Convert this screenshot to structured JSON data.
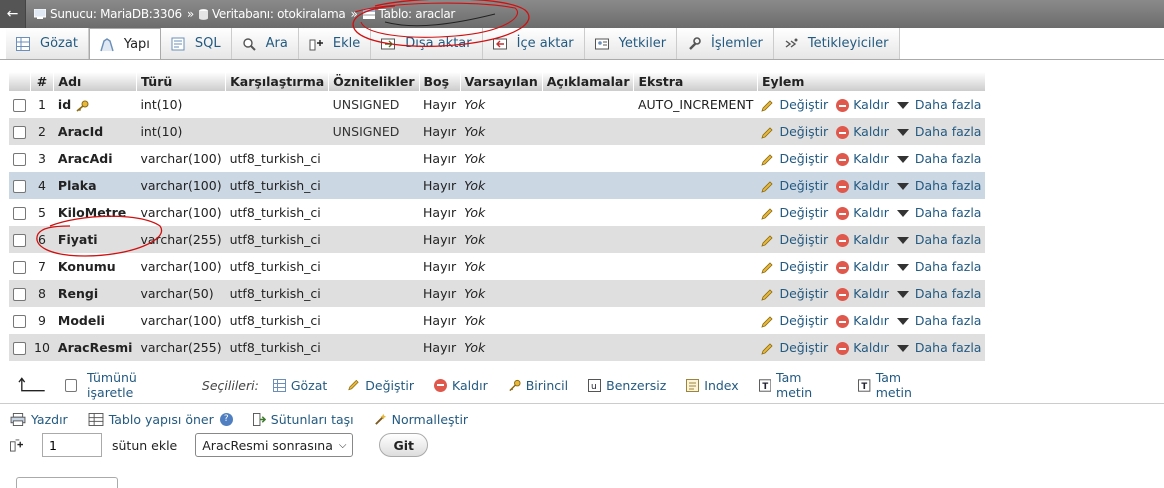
{
  "breadcrumb": {
    "server": "Sunucu: MariaDB:3306",
    "database": "Veritabanı: otokiralama",
    "table": "Tablo: araclar",
    "sep": "»"
  },
  "tabs": [
    {
      "label": "Gözat",
      "icon": "browse-icon"
    },
    {
      "label": "Yapı",
      "icon": "structure-icon",
      "active": true
    },
    {
      "label": "SQL",
      "icon": "sql-icon"
    },
    {
      "label": "Ara",
      "icon": "search-icon"
    },
    {
      "label": "Ekle",
      "icon": "insert-icon"
    },
    {
      "label": "Dışa aktar",
      "icon": "export-icon"
    },
    {
      "label": "İçe aktar",
      "icon": "import-icon"
    },
    {
      "label": "Yetkiler",
      "icon": "privileges-icon"
    },
    {
      "label": "İşlemler",
      "icon": "operations-icon"
    },
    {
      "label": "Tetikleyiciler",
      "icon": "triggers-icon"
    }
  ],
  "columns": [
    "#",
    "Adı",
    "Türü",
    "Karşılaştırma",
    "Öznitelikler",
    "Boş",
    "Varsayılan",
    "Açıklamalar",
    "Ekstra",
    "Eylem"
  ],
  "rows": [
    {
      "num": "1",
      "name": "id",
      "type": "int(10)",
      "collation": "",
      "attributes": "UNSIGNED",
      "null": "Hayır",
      "default": "Yok",
      "comments": "",
      "extra": "AUTO_INCREMENT",
      "primary": true
    },
    {
      "num": "2",
      "name": "AracId",
      "type": "int(10)",
      "collation": "",
      "attributes": "UNSIGNED",
      "null": "Hayır",
      "default": "Yok",
      "comments": "",
      "extra": ""
    },
    {
      "num": "3",
      "name": "AracAdi",
      "type": "varchar(100)",
      "collation": "utf8_turkish_ci",
      "attributes": "",
      "null": "Hayır",
      "default": "Yok",
      "comments": "",
      "extra": ""
    },
    {
      "num": "4",
      "name": "Plaka",
      "type": "varchar(100)",
      "collation": "utf8_turkish_ci",
      "attributes": "",
      "null": "Hayır",
      "default": "Yok",
      "comments": "",
      "extra": "",
      "highlight": true
    },
    {
      "num": "5",
      "name": "KiloMetre",
      "type": "varchar(100)",
      "collation": "utf8_turkish_ci",
      "attributes": "",
      "null": "Hayır",
      "default": "Yok",
      "comments": "",
      "extra": ""
    },
    {
      "num": "6",
      "name": "Fiyati",
      "type": "varchar(255)",
      "collation": "utf8_turkish_ci",
      "attributes": "",
      "null": "Hayır",
      "default": "Yok",
      "comments": "",
      "extra": ""
    },
    {
      "num": "7",
      "name": "Konumu",
      "type": "varchar(100)",
      "collation": "utf8_turkish_ci",
      "attributes": "",
      "null": "Hayır",
      "default": "Yok",
      "comments": "",
      "extra": ""
    },
    {
      "num": "8",
      "name": "Rengi",
      "type": "varchar(50)",
      "collation": "utf8_turkish_ci",
      "attributes": "",
      "null": "Hayır",
      "default": "Yok",
      "comments": "",
      "extra": ""
    },
    {
      "num": "9",
      "name": "Modeli",
      "type": "varchar(100)",
      "collation": "utf8_turkish_ci",
      "attributes": "",
      "null": "Hayır",
      "default": "Yok",
      "comments": "",
      "extra": ""
    },
    {
      "num": "10",
      "name": "AracResmi",
      "type": "varchar(255)",
      "collation": "utf8_turkish_ci",
      "attributes": "",
      "null": "Hayır",
      "default": "Yok",
      "comments": "",
      "extra": ""
    }
  ],
  "actions": {
    "change": "Değiştir",
    "drop": "Kaldır",
    "more": "Daha fazla"
  },
  "selection": {
    "check_all": "Tümünü işaretle",
    "with_selected": "Seçilileri:",
    "browse": "Gözat",
    "change": "Değiştir",
    "drop": "Kaldır",
    "primary": "Birincil",
    "unique": "Benzersiz",
    "index": "Index",
    "fulltext_1": "Tam metin",
    "fulltext_2": "Tam metin"
  },
  "tools": {
    "print": "Yazdır",
    "propose": "Tablo yapısı öner",
    "move_columns": "Sütunları taşı",
    "normalize": "Normalleştir"
  },
  "add_column": {
    "count": "1",
    "label": "sütun ekle",
    "position": "AracResmi sonrasına",
    "go": "Git"
  },
  "colors": {
    "link": "#235a81",
    "row_alt": "#dfdfdf",
    "row_highlight": "#ccd7e4",
    "drop": "#e0584b",
    "annotation": "#d01010"
  }
}
